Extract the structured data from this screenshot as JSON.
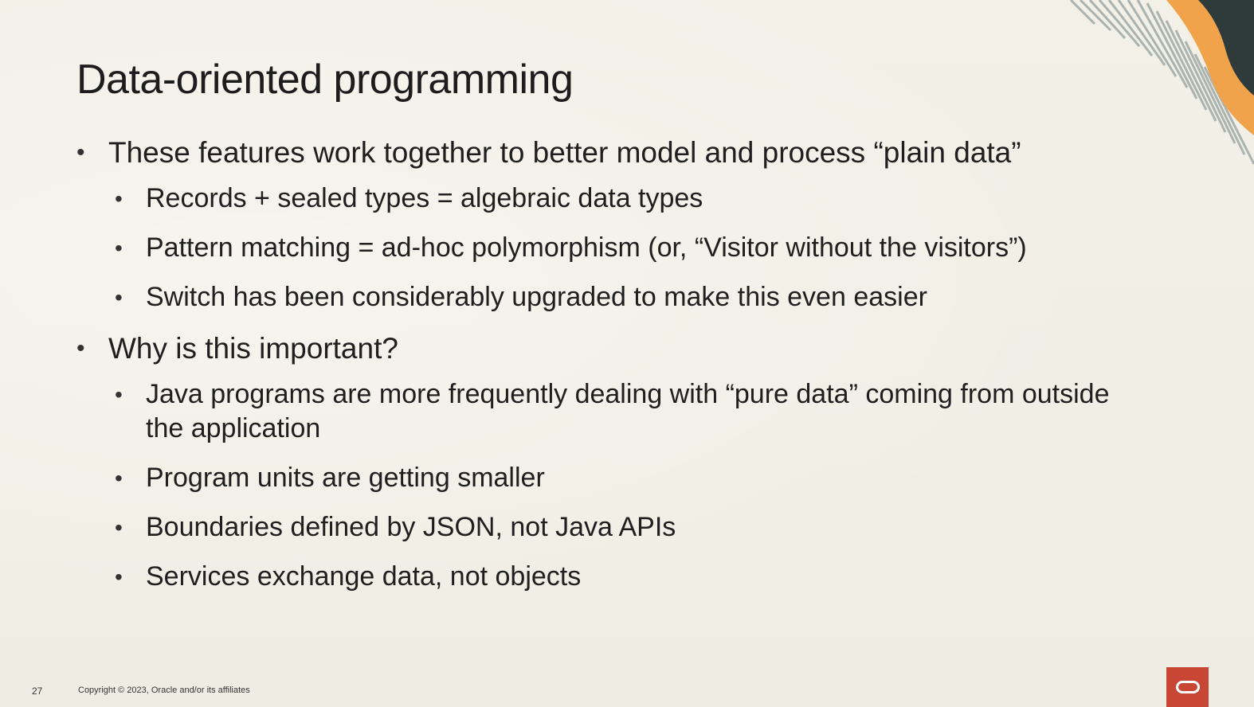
{
  "slide": {
    "title": "Data-oriented programming",
    "bullets": [
      {
        "text": "These features work together to better model and process “plain data”",
        "subitems": [
          "Records + sealed types = algebraic data types",
          "Pattern matching = ad-hoc polymorphism (or, “Visitor without the visitors”)",
          "Switch has been considerably upgraded to make this even easier"
        ]
      },
      {
        "text": "Why is this important?",
        "subitems": [
          "Java programs are more frequently dealing with “pure data” coming from outside the application",
          "Program units are getting smaller",
          "Boundaries defined by JSON, not Java APIs",
          "Services exchange data, not objects"
        ]
      }
    ],
    "footer": {
      "page_number": "27",
      "copyright": "Copyright © 2023, Oracle and/or its affiliates"
    },
    "logo_icon": "oracle-logo-icon"
  },
  "colors": {
    "background": "#f1efe6",
    "text": "#1f1f1f",
    "accent_orange": "#f0a34a",
    "accent_dark": "#2f3a3a",
    "oracle_red": "#c74634"
  }
}
